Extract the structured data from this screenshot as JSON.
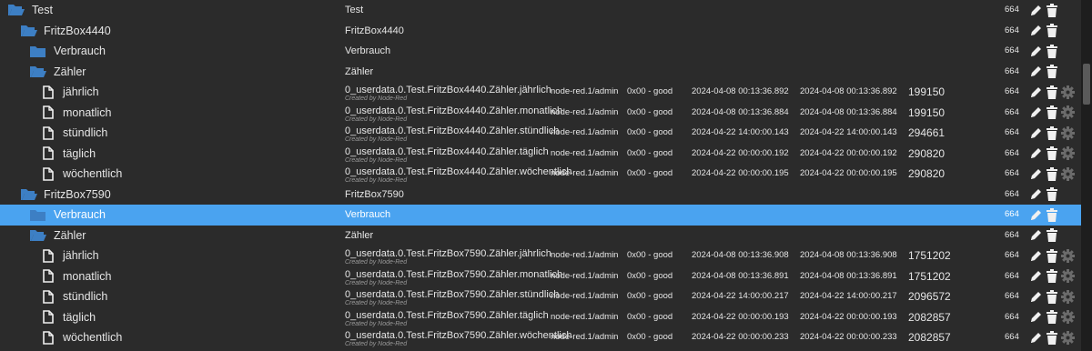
{
  "created_by": "Created by Node-Red",
  "rows": [
    {
      "name": "Test",
      "level": 0,
      "type": "folder-open",
      "desc": "Test",
      "acl": "664"
    },
    {
      "name": "FritzBox4440",
      "level": 1,
      "type": "folder-open",
      "desc": "FritzBox4440",
      "acl": "664"
    },
    {
      "name": "Verbrauch",
      "level": 2,
      "type": "folder",
      "desc": "Verbrauch",
      "acl": "664"
    },
    {
      "name": "Zähler",
      "level": 2,
      "type": "folder-open",
      "desc": "Zähler",
      "acl": "664"
    },
    {
      "name": "jährlich",
      "level": 3,
      "type": "state",
      "id": "0_userdata.0.Test.FritzBox4440.Zähler.jährlich",
      "from": "node-red.1/admin",
      "quality": "0x00 - good",
      "ts": "2024-04-08 00:13:36.892",
      "lc": "2024-04-08 00:13:36.892",
      "value": "199150",
      "acl": "664"
    },
    {
      "name": "monatlich",
      "level": 3,
      "type": "state",
      "id": "0_userdata.0.Test.FritzBox4440.Zähler.monatlich",
      "from": "node-red.1/admin",
      "quality": "0x00 - good",
      "ts": "2024-04-08 00:13:36.884",
      "lc": "2024-04-08 00:13:36.884",
      "value": "199150",
      "acl": "664"
    },
    {
      "name": "stündlich",
      "level": 3,
      "type": "state",
      "id": "0_userdata.0.Test.FritzBox4440.Zähler.stündlich",
      "from": "node-red.1/admin",
      "quality": "0x00 - good",
      "ts": "2024-04-22 14:00:00.143",
      "lc": "2024-04-22 14:00:00.143",
      "value": "294661",
      "acl": "664"
    },
    {
      "name": "täglich",
      "level": 3,
      "type": "state",
      "id": "0_userdata.0.Test.FritzBox4440.Zähler.täglich",
      "from": "node-red.1/admin",
      "quality": "0x00 - good",
      "ts": "2024-04-22 00:00:00.192",
      "lc": "2024-04-22 00:00:00.192",
      "value": "290820",
      "acl": "664"
    },
    {
      "name": "wöchentlich",
      "level": 3,
      "type": "state",
      "id": "0_userdata.0.Test.FritzBox4440.Zähler.wöchentlich",
      "from": "node-red.1/admin",
      "quality": "0x00 - good",
      "ts": "2024-04-22 00:00:00.195",
      "lc": "2024-04-22 00:00:00.195",
      "value": "290820",
      "acl": "664"
    },
    {
      "name": "FritzBox7590",
      "level": 1,
      "type": "folder-open",
      "desc": "FritzBox7590",
      "acl": "664"
    },
    {
      "name": "Verbrauch",
      "level": 2,
      "type": "folder",
      "desc": "Verbrauch",
      "acl": "664",
      "selected": true
    },
    {
      "name": "Zähler",
      "level": 2,
      "type": "folder-open",
      "desc": "Zähler",
      "acl": "664"
    },
    {
      "name": "jährlich",
      "level": 3,
      "type": "state",
      "id": "0_userdata.0.Test.FritzBox7590.Zähler.jährlich",
      "from": "node-red.1/admin",
      "quality": "0x00 - good",
      "ts": "2024-04-08 00:13:36.908",
      "lc": "2024-04-08 00:13:36.908",
      "value": "1751202",
      "acl": "664"
    },
    {
      "name": "monatlich",
      "level": 3,
      "type": "state",
      "id": "0_userdata.0.Test.FritzBox7590.Zähler.monatlich",
      "from": "node-red.1/admin",
      "quality": "0x00 - good",
      "ts": "2024-04-08 00:13:36.891",
      "lc": "2024-04-08 00:13:36.891",
      "value": "1751202",
      "acl": "664"
    },
    {
      "name": "stündlich",
      "level": 3,
      "type": "state",
      "id": "0_userdata.0.Test.FritzBox7590.Zähler.stündlich",
      "from": "node-red.1/admin",
      "quality": "0x00 - good",
      "ts": "2024-04-22 14:00:00.217",
      "lc": "2024-04-22 14:00:00.217",
      "value": "2096572",
      "acl": "664"
    },
    {
      "name": "täglich",
      "level": 3,
      "type": "state",
      "id": "0_userdata.0.Test.FritzBox7590.Zähler.täglich",
      "from": "node-red.1/admin",
      "quality": "0x00 - good",
      "ts": "2024-04-22 00:00:00.193",
      "lc": "2024-04-22 00:00:00.193",
      "value": "2082857",
      "acl": "664"
    },
    {
      "name": "wöchentlich",
      "level": 3,
      "type": "state",
      "id": "0_userdata.0.Test.FritzBox7590.Zähler.wöchentlich",
      "from": "node-red.1/admin",
      "quality": "0x00 - good",
      "ts": "2024-04-22 00:00:00.233",
      "lc": "2024-04-22 00:00:00.233",
      "value": "2082857",
      "acl": "664"
    }
  ],
  "colors": {
    "background": "#2b2b2b",
    "folder": "#3d7fc4",
    "selected": "#4aa3f0",
    "text": "#e6e6e6",
    "icon": "#f0f0f0",
    "gear": "#6b6b6b"
  }
}
